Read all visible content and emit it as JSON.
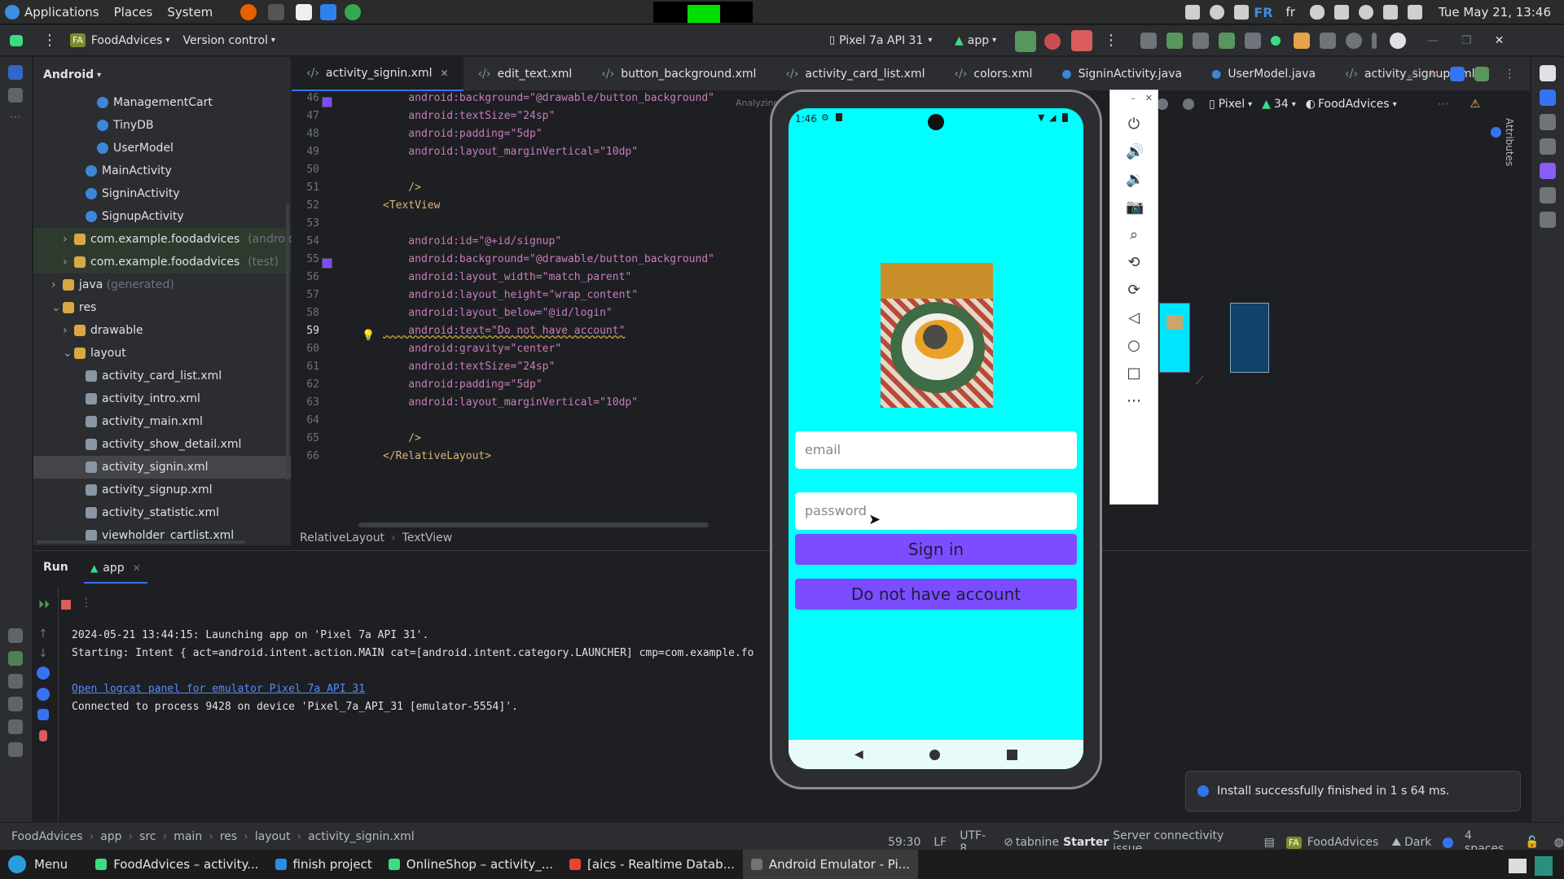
{
  "os_panel": {
    "menus": [
      "Applications",
      "Places",
      "System"
    ],
    "keyboard_layout": "FR",
    "keyboard_layout_lower": "fr",
    "datetime": "Tue May 21, 13:46"
  },
  "ide": {
    "project_badge": "FA",
    "project_name": "FoodAdvices",
    "version_control": "Version control",
    "device_selector": "Pixel 7a API 31",
    "run_config": "app"
  },
  "project_panel": {
    "view_label": "Android",
    "tree": [
      {
        "label": "ManagementCart",
        "suffix": "",
        "indent": 5,
        "kind": "class"
      },
      {
        "label": "TinyDB",
        "suffix": "",
        "indent": 5,
        "kind": "class"
      },
      {
        "label": "UserModel",
        "suffix": "",
        "indent": 5,
        "kind": "class"
      },
      {
        "label": "MainActivity",
        "suffix": "",
        "indent": 4,
        "kind": "class"
      },
      {
        "label": "SigninActivity",
        "suffix": "",
        "indent": 4,
        "kind": "class"
      },
      {
        "label": "SignupActivity",
        "suffix": "",
        "indent": 4,
        "kind": "class"
      },
      {
        "label": "com.example.foodadvices",
        "suffix": " (androidTe",
        "indent": 3,
        "kind": "pkg",
        "arrow": "›"
      },
      {
        "label": "com.example.foodadvices",
        "suffix": " (test)",
        "indent": 3,
        "kind": "pkg",
        "arrow": "›"
      },
      {
        "label": "java",
        "suffix": " (generated)",
        "indent": 2,
        "kind": "folder",
        "arrow": "›"
      },
      {
        "label": "res",
        "suffix": "",
        "indent": 2,
        "kind": "folder",
        "arrow": "⌄"
      },
      {
        "label": "drawable",
        "suffix": "",
        "indent": 3,
        "kind": "folder",
        "arrow": "›"
      },
      {
        "label": "layout",
        "suffix": "",
        "indent": 3,
        "kind": "folder",
        "arrow": "⌄"
      },
      {
        "label": "activity_card_list.xml",
        "suffix": "",
        "indent": 4,
        "kind": "xml"
      },
      {
        "label": "activity_intro.xml",
        "suffix": "",
        "indent": 4,
        "kind": "xml"
      },
      {
        "label": "activity_main.xml",
        "suffix": "",
        "indent": 4,
        "kind": "xml"
      },
      {
        "label": "activity_show_detail.xml",
        "suffix": "",
        "indent": 4,
        "kind": "xml"
      },
      {
        "label": "activity_signin.xml",
        "suffix": "",
        "indent": 4,
        "kind": "xml",
        "selected": true
      },
      {
        "label": "activity_signup.xml",
        "suffix": "",
        "indent": 4,
        "kind": "xml"
      },
      {
        "label": "activity_statistic.xml",
        "suffix": "",
        "indent": 4,
        "kind": "xml"
      },
      {
        "label": "viewholder_cartlist.xml",
        "suffix": "",
        "indent": 4,
        "kind": "xml"
      }
    ]
  },
  "editor": {
    "tabs": [
      "activity_signin.xml",
      "edit_text.xml",
      "button_background.xml",
      "activity_card_list.xml",
      "colors.xml",
      "SigninActivity.java",
      "UserModel.java",
      "activity_signup.xml"
    ],
    "analyzing": "Analyzing",
    "lines": [
      {
        "n": "46",
        "t": "    android:background=\"@drawable/button_background\""
      },
      {
        "n": "47",
        "t": "    android:textSize=\"24sp\""
      },
      {
        "n": "48",
        "t": "    android:padding=\"5dp\""
      },
      {
        "n": "49",
        "t": "    android:layout_marginVertical=\"10dp\""
      },
      {
        "n": "50",
        "t": ""
      },
      {
        "n": "51",
        "t": "    />"
      },
      {
        "n": "52",
        "t": "<TextView"
      },
      {
        "n": "53",
        "t": ""
      },
      {
        "n": "54",
        "t": "    android:id=\"@+id/signup\""
      },
      {
        "n": "55",
        "t": "    android:background=\"@drawable/button_background\""
      },
      {
        "n": "56",
        "t": "    android:layout_width=\"match_parent\""
      },
      {
        "n": "57",
        "t": "    android:layout_height=\"wrap_content\""
      },
      {
        "n": "58",
        "t": "    android:layout_below=\"@id/login\""
      },
      {
        "n": "59",
        "t": "    android:text=\"Do not have account\""
      },
      {
        "n": "60",
        "t": "    android:gravity=\"center\""
      },
      {
        "n": "61",
        "t": "    android:textSize=\"24sp\""
      },
      {
        "n": "62",
        "t": "    android:padding=\"5dp\""
      },
      {
        "n": "63",
        "t": "    android:layout_marginVertical=\"10dp\""
      },
      {
        "n": "64",
        "t": ""
      },
      {
        "n": "65",
        "t": "    />"
      },
      {
        "n": "66",
        "t": "</RelativeLayout>"
      }
    ],
    "breadcrumb": [
      "RelativeLayout",
      "TextView"
    ]
  },
  "design_toolbar": {
    "device": "Pixel",
    "api": "34",
    "theme": "FoodAdvices",
    "attributes_label": "Attributes"
  },
  "run_panel": {
    "tab_run": "Run",
    "tab_app": "app",
    "log_lines": [
      "2024-05-21 13:44:15: Launching app on 'Pixel 7a API 31'.",
      "Starting: Intent { act=android.intent.action.MAIN cat=[android.intent.category.LAUNCHER] cmp=com.example.fo"
    ],
    "logcat_link": "Open logcat panel for emulator Pixel 7a API 31",
    "connected": "Connected to process 9428 on device 'Pixel_7a_API_31 [emulator-5554]'."
  },
  "phone": {
    "time": "1:46",
    "email_placeholder": "email",
    "password_placeholder": "password",
    "signin_label": "Sign in",
    "signup_label": "Do not have account",
    "bg_color": "#00ffff",
    "button_color": "#7c4dff"
  },
  "toast": {
    "message": "Install successfully finished in 1 s 64 ms."
  },
  "status_bar": {
    "breadcrumb": [
      "FoodAdvices",
      "app",
      "src",
      "main",
      "res",
      "layout",
      "activity_signin.xml"
    ],
    "position": "59:30",
    "line_sep": "LF",
    "encoding": "UTF-8",
    "tabnine_brand": "tabnine",
    "tabnine_tier": "Starter",
    "tabnine_status": "Server connectivity issue",
    "project": "FoodAdvices",
    "theme": "Dark",
    "indent": "4 spaces"
  },
  "taskbar": {
    "menu": "Menu",
    "items": [
      "FoodAdvices – activity...",
      "finish project",
      "OnlineShop – activity_...",
      "[aics - Realtime Datab...",
      "Android Emulator - Pi..."
    ]
  }
}
